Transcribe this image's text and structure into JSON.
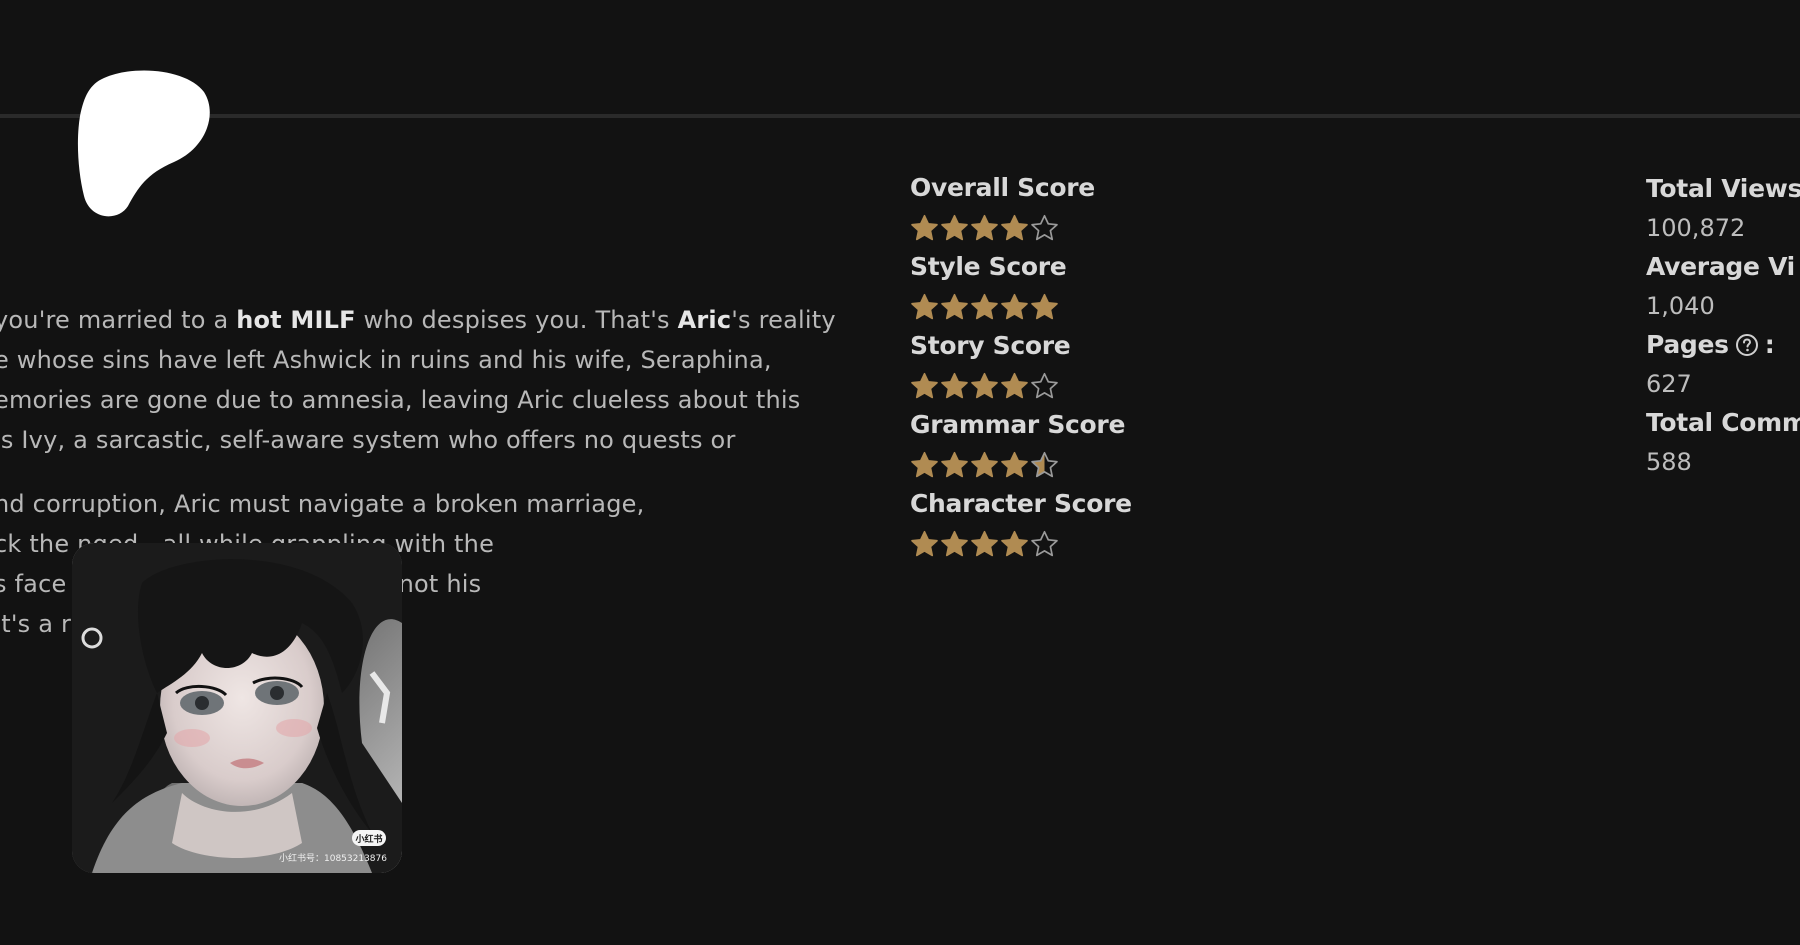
{
  "logo": {
    "icon": "patreon-logo-icon",
    "color": "#ffffff"
  },
  "synopsis": {
    "line1_a": "you're married to a ",
    "line1_b": "hot MILF",
    "line1_c": " who despises you. That's ",
    "line1_d": "Aric",
    "line1_e": "'s reality",
    "line2": "e whose sins have left Ashwick in ruins and his wife, Seraphina,",
    "line3": "emories are gone due to amnesia, leaving Aric clueless about this",
    "line4": "is Ivy, a sarcastic, self-aware system who offers no quests or",
    "line5": "nd corruption, Aric must navigate a broken marriage,",
    "line6": "ck the                          nged—all while grappling with the",
    "line7": "s face                         edeeming himself in a life not his",
    "line8": "It's a r"
  },
  "cover": {
    "watermark_badge": "小红书",
    "watermark_id": "小红书号：10853213876"
  },
  "scores": [
    {
      "label": "Overall Score",
      "rating": 4,
      "max": 5
    },
    {
      "label": "Style Score",
      "rating": 5,
      "max": 5
    },
    {
      "label": "Story Score",
      "rating": 4,
      "max": 5
    },
    {
      "label": "Grammar Score",
      "rating": 4.5,
      "max": 5
    },
    {
      "label": "Character Score",
      "rating": 4,
      "max": 5
    }
  ],
  "stats": {
    "total_views_label": "Total Views",
    "total_views_value": "100,872",
    "average_views_label": "Average Vi",
    "average_views_value": "1,040",
    "pages_label": "Pages",
    "pages_colon": ":",
    "pages_value": "627",
    "total_comments_label": "Total Comm",
    "total_comments_value": "588"
  },
  "colors": {
    "background": "#121212",
    "divider": "#2a2a2a",
    "star_fill": "#b08b52",
    "star_outline": "#9a9a9a",
    "text": "#c9c9c9"
  }
}
